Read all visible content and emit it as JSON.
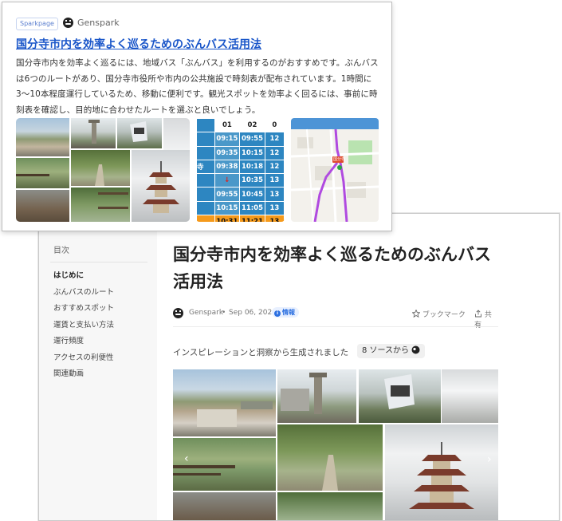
{
  "card": {
    "tag": "Sparkpage",
    "brand": "Genspark",
    "title": "国分寺市内を効率よく巡るためのぶんバス活用法",
    "body": "国分寺市内を効率よく巡るには、地域バス「ぶんバス」を利用するのがおすすめです。ぶんバスは6つのルートがあり、国分寺市役所や市内の公共施設で時刻表が配布されています。1時間に3〜10本程度運行しているため、移動に便利です。観光スポットを効率よく回るには、事前に時刻表を確認し、目的地に合わせたルートを選ぶと良いでしょう。",
    "timetable": {
      "headers": [
        "",
        "01",
        "02",
        "0"
      ],
      "rows": [
        [
          "",
          "09:15",
          "09:55",
          "12"
        ],
        [
          "",
          "09:35",
          "10:15",
          "12"
        ],
        [
          "寺",
          "09:38",
          "10:18",
          "12"
        ],
        [
          "",
          "↓",
          "10:35",
          "13"
        ],
        [
          "",
          "09:55",
          "10:45",
          "13"
        ],
        [
          "",
          "10:15",
          "11:05",
          "13"
        ],
        [
          "",
          "10:31",
          "11:21",
          "13"
        ]
      ]
    },
    "map_pin_label": "国分寺"
  },
  "toc": {
    "title": "目次",
    "caret": "˄",
    "items": [
      {
        "label": "はじめに",
        "active": true
      },
      {
        "label": "ぶんバスのルート"
      },
      {
        "label": "おすすめスポット"
      },
      {
        "label": "運賃と支払い方法"
      },
      {
        "label": "運行頻度"
      },
      {
        "label": "アクセスの利便性"
      },
      {
        "label": "関連動画"
      }
    ]
  },
  "article": {
    "title": "国分寺市内を効率よく巡るためのぶんバス活用法",
    "author": "Genspark",
    "separator": "•",
    "date": "Sep 06, 2024",
    "tag": "情報",
    "bookmark": "ブックマーク",
    "share": "共有",
    "inspiration": "インスピレーションと洞察から生成されました",
    "sources": "8 ソースから",
    "gallery_prev": "‹",
    "gallery_next": "›"
  },
  "icons": {
    "bookmark": "star-outline-icon",
    "share": "share-icon",
    "sources": "avatar-stack-icon",
    "info": "info-icon"
  },
  "colors": {
    "link": "#1a56c9",
    "tag_bg": "#e8f0ff",
    "tag_fg": "#2b6fe0",
    "timetable_blue": "#2d86c1",
    "timetable_orange": "#f59a1c"
  }
}
